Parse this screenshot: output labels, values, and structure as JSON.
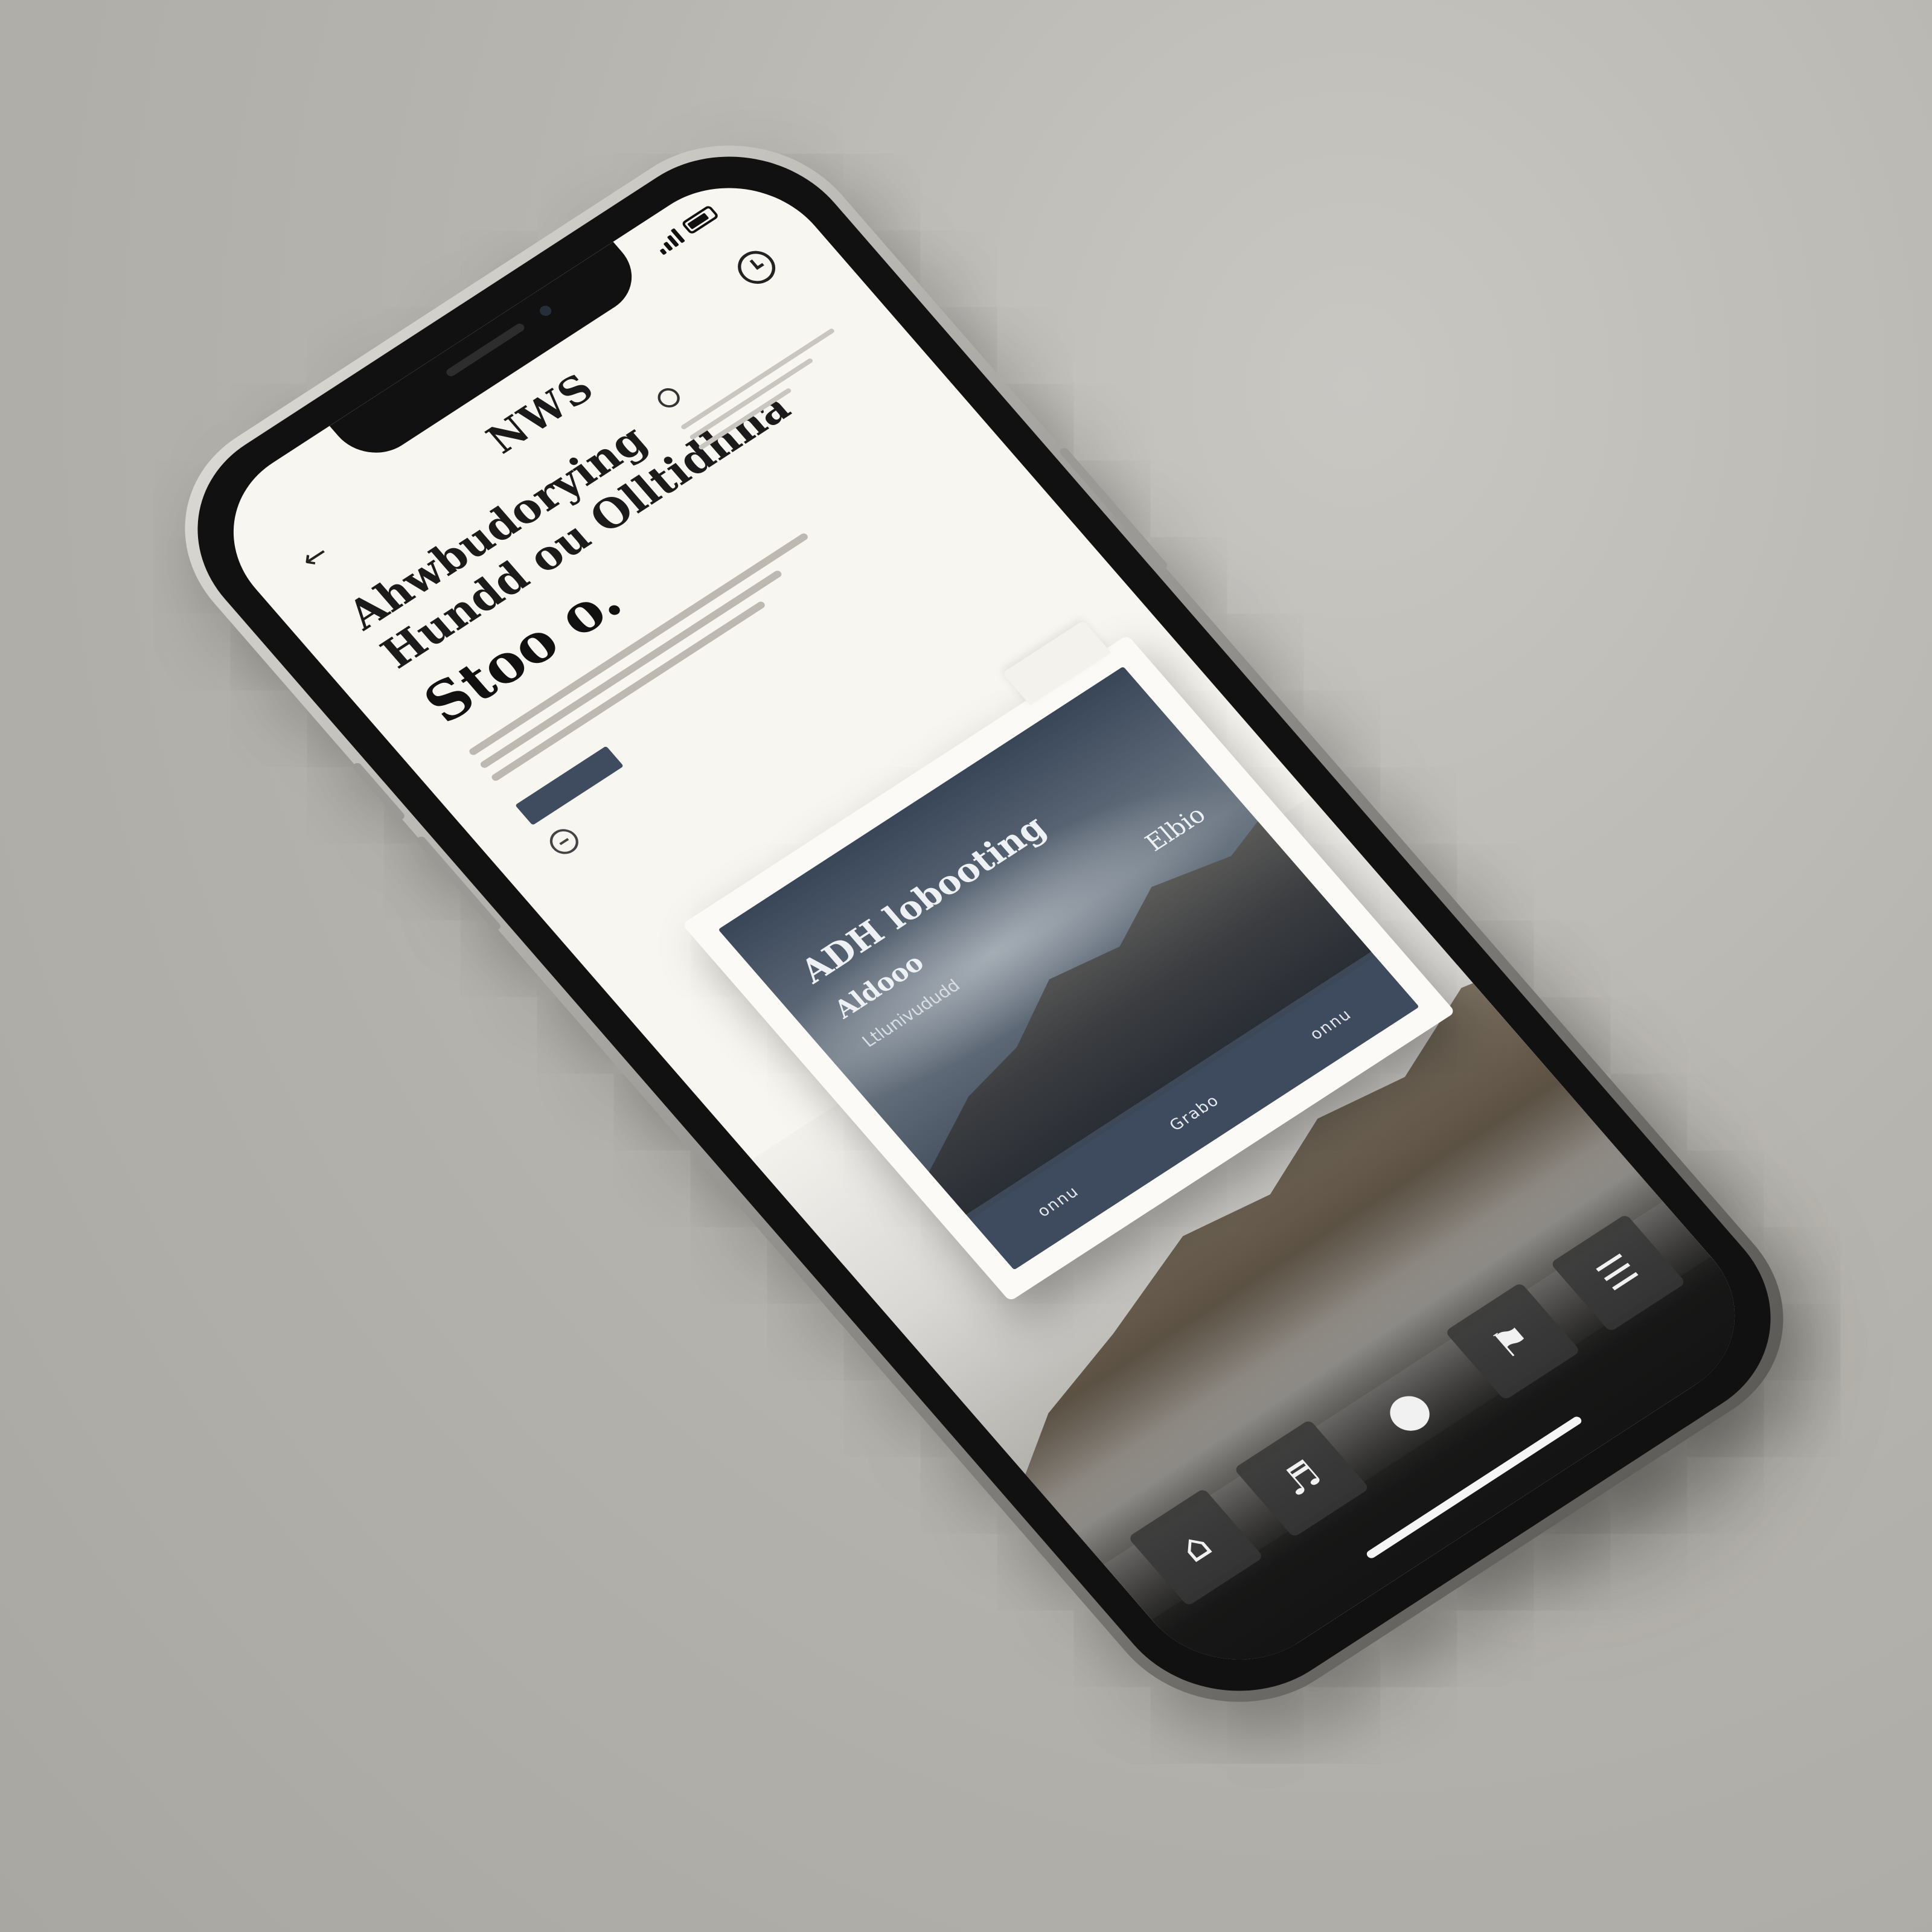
{
  "status_bar": {
    "time": "",
    "signal": "signal-icon",
    "battery": "battery-icon"
  },
  "header": {
    "brand": "NWS",
    "back_icon": "back-arrow-icon",
    "clock_icon": "clock-icon"
  },
  "article": {
    "headline": "Ahwbudorying",
    "headline_line2": "Hundd ou Olltidhna",
    "headline_large": "Stoo o.",
    "side_time": "",
    "byline": "",
    "read_button": ""
  },
  "card": {
    "title": "ADH lobooting",
    "subtitle": "Aldooo",
    "desc": "Ltlunivududd",
    "tag": "Elbio",
    "footer_items": [
      "onnu",
      "Grabo",
      "onnu"
    ]
  },
  "tab_bar": {
    "items": [
      {
        "label": "",
        "icon": "home-icon"
      },
      {
        "label": "",
        "icon": "headphones-icon"
      },
      {
        "label": "",
        "icon": "profile-icon"
      },
      {
        "label": "",
        "icon": "bookmark-icon"
      },
      {
        "label": "",
        "icon": "menu-icon"
      }
    ]
  },
  "colors": {
    "accent": "#3e4b5f",
    "paper": "#f8f6f0",
    "ink": "#111111"
  }
}
